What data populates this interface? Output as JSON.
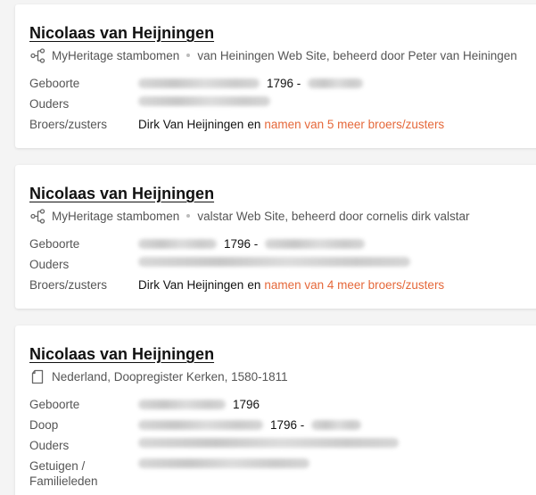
{
  "results": [
    {
      "title": "Nicolaas van Heijningen",
      "source_icon": "tree-icon",
      "source_primary": "MyHeritage stambomen",
      "source_secondary": "van Heiningen Web Site, beheerd door Peter van Heiningen",
      "birth_label": "Geboorte",
      "birth_year": "1796 -",
      "parents_label": "Ouders",
      "siblings_label": "Broers/zusters",
      "sibling_name": "Dirk Van Heijningen",
      "sibling_conj": "en",
      "sibling_more": "namen van 5 meer broers/zusters"
    },
    {
      "title": "Nicolaas van Heijningen",
      "source_icon": "tree-icon",
      "source_primary": "MyHeritage stambomen",
      "source_secondary": "valstar Web Site, beheerd door cornelis dirk valstar",
      "birth_label": "Geboorte",
      "birth_year": "1796 -",
      "parents_label": "Ouders",
      "siblings_label": "Broers/zusters",
      "sibling_name": "Dirk Van Heijningen",
      "sibling_conj": "en",
      "sibling_more": "namen van 4 meer broers/zusters"
    },
    {
      "title": "Nicolaas van Heijningen",
      "source_icon": "document-icon",
      "source_primary": "Nederland, Doopregister Kerken, 1580-1811",
      "birth_label": "Geboorte",
      "birth_year": "1796",
      "baptism_label": "Doop",
      "baptism_year": "1796 -",
      "parents_label": "Ouders",
      "witnesses_label_1": "Getuigen /",
      "witnesses_label_2": "Familieleden"
    }
  ],
  "colors": {
    "link": "#e5683a",
    "title": "#111111",
    "label": "#555555"
  }
}
